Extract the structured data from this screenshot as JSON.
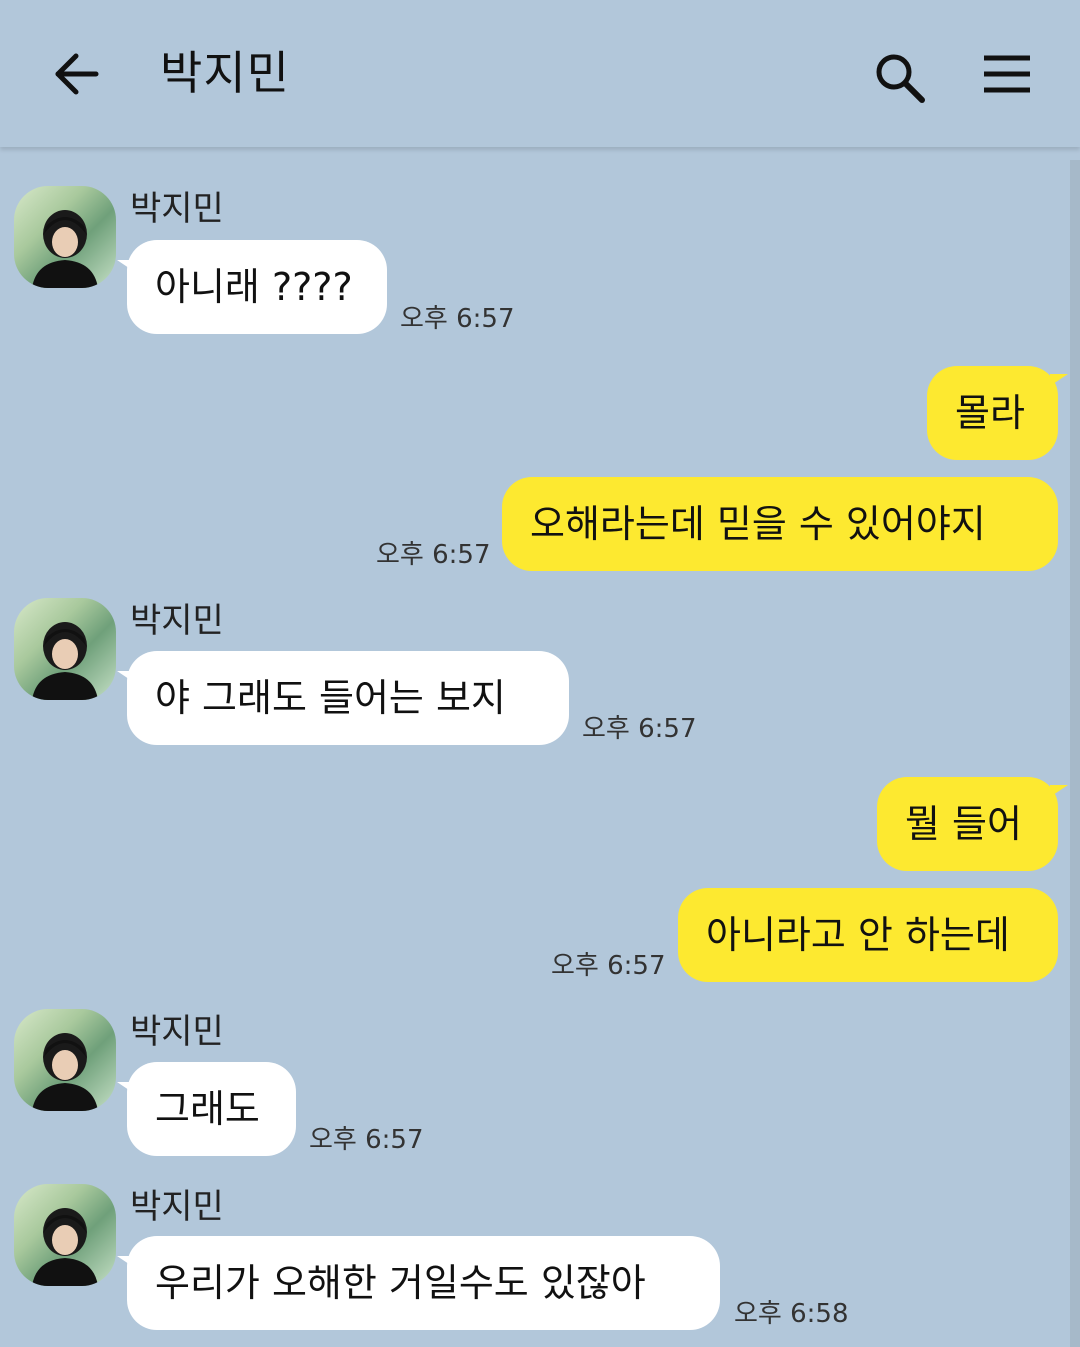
{
  "header": {
    "title": "박지민",
    "back_icon": "arrow-left-icon",
    "search_icon": "search-icon",
    "menu_icon": "hamburger-menu-icon"
  },
  "colors": {
    "background": "#b2c7da",
    "incoming_bubble": "#ffffff",
    "outgoing_bubble": "#fde930"
  },
  "messages": [
    {
      "sender": "박지민",
      "text": "아니래 ????",
      "time": "오후 6:57",
      "direction": "in"
    },
    {
      "sender": "",
      "text": "몰라",
      "time": "",
      "direction": "out"
    },
    {
      "sender": "",
      "text": "오해라는데 믿을 수 있어야지",
      "time": "오후 6:57",
      "direction": "out"
    },
    {
      "sender": "박지민",
      "text": "야 그래도 들어는 보지",
      "time": "오후 6:57",
      "direction": "in"
    },
    {
      "sender": "",
      "text": "뭘 들어",
      "time": "",
      "direction": "out"
    },
    {
      "sender": "",
      "text": "아니라고 안 하는데",
      "time": "오후 6:57",
      "direction": "out"
    },
    {
      "sender": "박지민",
      "text": "그래도",
      "time": "오후 6:57",
      "direction": "in"
    },
    {
      "sender": "박지민",
      "text": "우리가 오해한 거일수도 있잖아",
      "time": "오후 6:58",
      "direction": "in"
    }
  ]
}
